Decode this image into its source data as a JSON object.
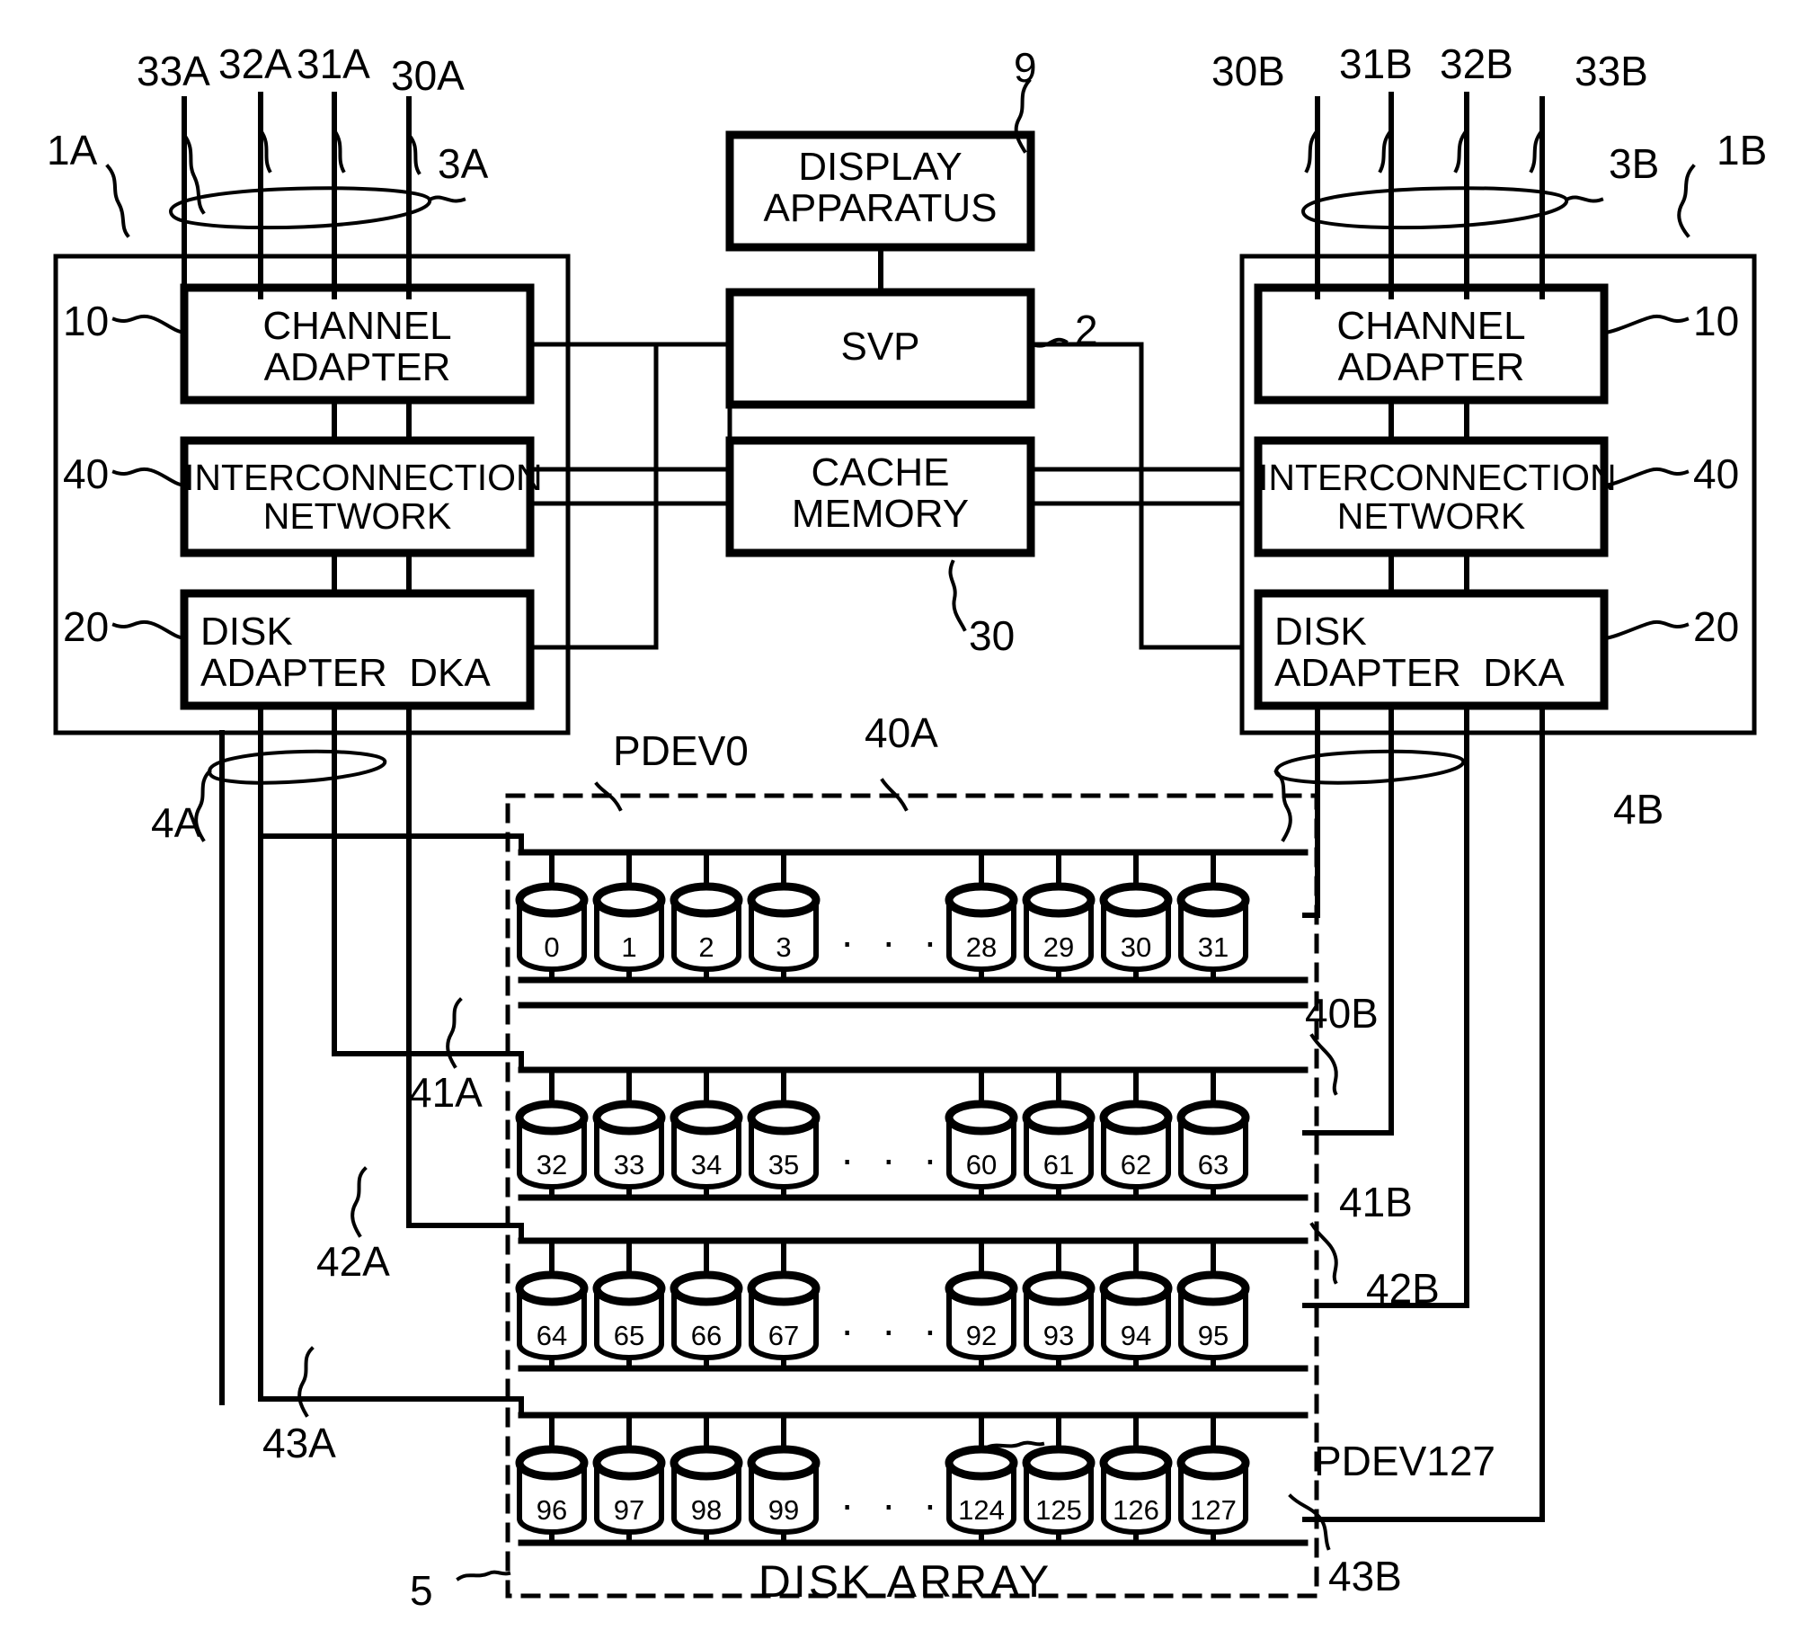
{
  "figure": {
    "kind": "patent-block-diagram",
    "title_text": "DISK ARRAY"
  },
  "subsystem_a": {
    "ref": "1A",
    "bus_group_ref": "3A",
    "host_lines": [
      "33A",
      "32A",
      "31A",
      "30A"
    ],
    "blocks": [
      {
        "ref": "10",
        "label": "CHANNEL\nADAPTER"
      },
      {
        "ref": "40",
        "label": "INTERCONNECTION\nNETWORK"
      },
      {
        "ref": "20",
        "label": "DISK\nADAPTER  DKA"
      }
    ],
    "disk_bus_group_ref": "4A",
    "disk_bus_refs": [
      "41A",
      "42A",
      "43A"
    ]
  },
  "subsystem_b": {
    "ref": "1B",
    "bus_group_ref": "3B",
    "host_lines": [
      "30B",
      "31B",
      "32B",
      "33B"
    ],
    "blocks": [
      {
        "ref": "10",
        "label": "CHANNEL\nADAPTER"
      },
      {
        "ref": "40",
        "label": "INTERCONNECTION\nNETWORK"
      },
      {
        "ref": "20",
        "label": "DISK\nADAPTER  DKA"
      }
    ],
    "disk_bus_group_ref": "4B",
    "disk_bus_refs": [
      "40B",
      "41B",
      "42B",
      "43B"
    ]
  },
  "center": {
    "blocks": [
      {
        "ref": "9",
        "label": "DISPLAY\nAPPARATUS"
      },
      {
        "ref": "2",
        "label": "SVP"
      },
      {
        "ref": "30",
        "label": "CACHE\nMEMORY"
      }
    ]
  },
  "disk_array": {
    "ref": "5",
    "caption": "DISK ARRAY",
    "first_pdev_label": "PDEV0",
    "last_pdev_label": "PDEV127",
    "bus_ref_left_top": "40A",
    "ellipsis": "· · ·",
    "rows": [
      {
        "left": [
          "0",
          "1",
          "2",
          "3"
        ],
        "right": [
          "28",
          "29",
          "30",
          "31"
        ]
      },
      {
        "left": [
          "32",
          "33",
          "34",
          "35"
        ],
        "right": [
          "60",
          "61",
          "62",
          "63"
        ]
      },
      {
        "left": [
          "64",
          "65",
          "66",
          "67"
        ],
        "right": [
          "92",
          "93",
          "94",
          "95"
        ]
      },
      {
        "left": [
          "96",
          "97",
          "98",
          "99"
        ],
        "right": [
          "124",
          "125",
          "126",
          "127"
        ]
      }
    ]
  },
  "colors": {
    "ink": "#000000",
    "paper": "#ffffff"
  }
}
